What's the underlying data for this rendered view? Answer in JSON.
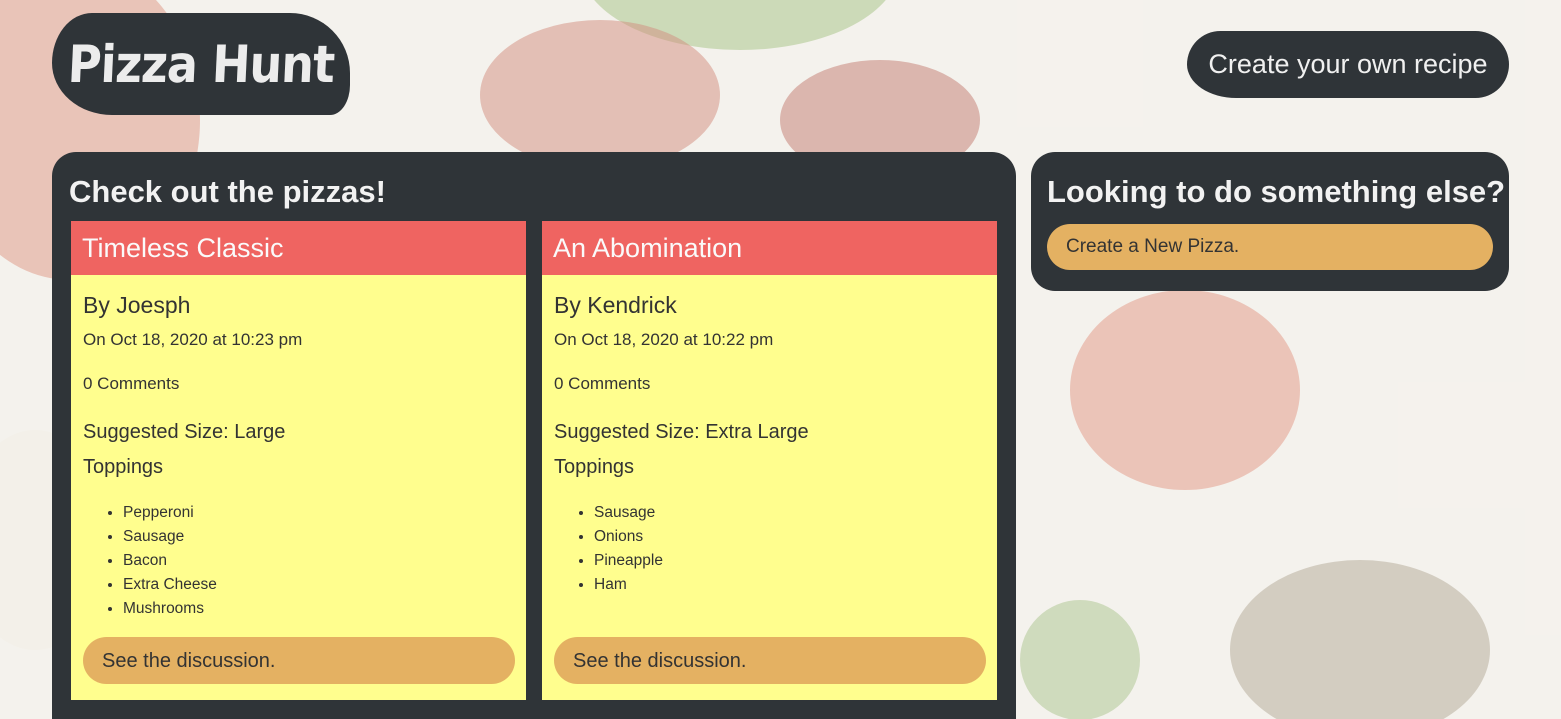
{
  "header": {
    "logo_text": "Pizza Hunt",
    "create_recipe_label": "Create your own recipe"
  },
  "main": {
    "title": "Check out the pizzas!",
    "pizzas": [
      {
        "name": "Timeless Classic",
        "author": "By Joesph",
        "date": "On Oct 18, 2020 at 10:23 pm",
        "comments": "0 Comments",
        "size": "Suggested Size: Large",
        "toppings_label": "Toppings",
        "toppings": [
          "Pepperoni",
          "Sausage",
          "Bacon",
          "Extra Cheese",
          "Mushrooms"
        ],
        "discussion_label": "See the discussion."
      },
      {
        "name": "An Abomination",
        "author": "By Kendrick",
        "date": "On Oct 18, 2020 at 10:22 pm",
        "comments": "0 Comments",
        "size": "Suggested Size: Extra Large",
        "toppings_label": "Toppings",
        "toppings": [
          "Sausage",
          "Onions",
          "Pineapple",
          "Ham"
        ],
        "discussion_label": "See the discussion."
      }
    ]
  },
  "side": {
    "title": "Looking to do something else?",
    "new_pizza_label": "Create a New Pizza."
  },
  "colors": {
    "panel": "#2f3438",
    "card_header": "#ef6461",
    "card_body": "#fffe8e",
    "button": "#e4b162"
  }
}
